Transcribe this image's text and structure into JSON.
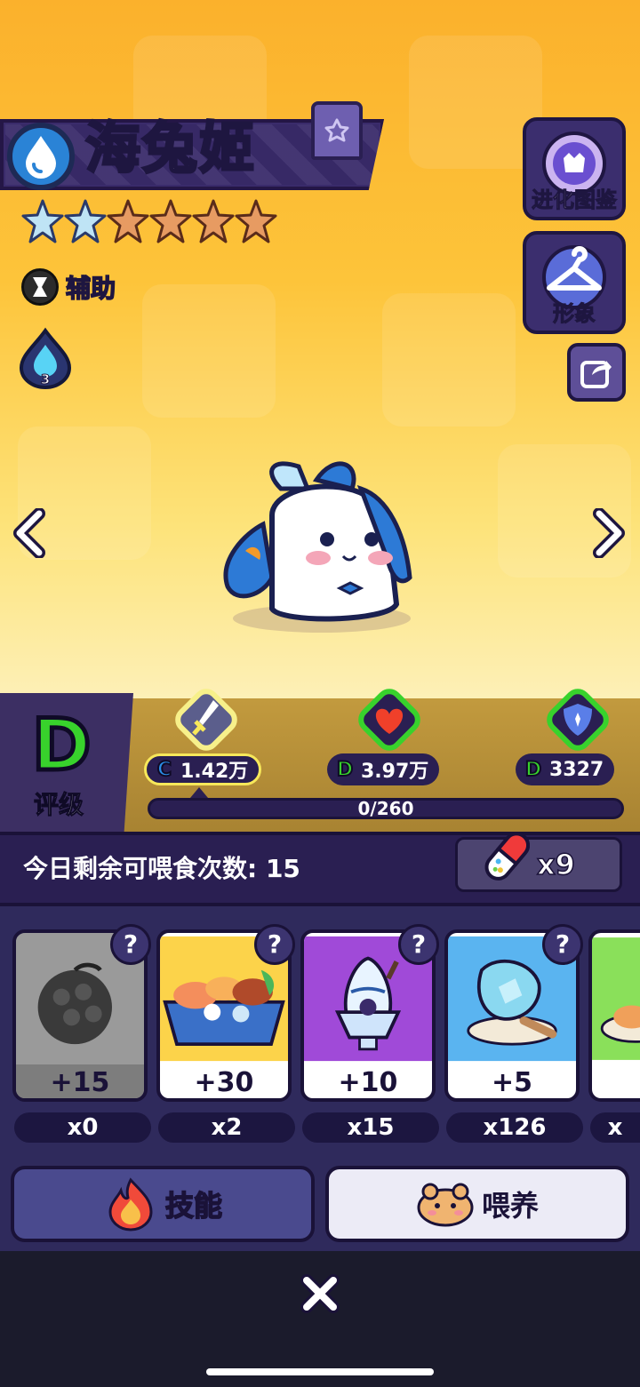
{
  "pet": {
    "name": "海兔姬",
    "element": "water",
    "stars_filled": 2,
    "stars_total": 6,
    "role": "辅助",
    "drop_level": "3"
  },
  "side": {
    "evolution_label": "进化图鉴",
    "appearance_label": "形象"
  },
  "grade": {
    "letter": "D",
    "label": "评级"
  },
  "stats": {
    "attack": {
      "grade": "C",
      "value": "1.42万"
    },
    "hp": {
      "grade": "D",
      "value": "3.97万"
    },
    "defense": {
      "grade": "D",
      "value": "3327"
    },
    "progress_text": "0/260",
    "progress_value": 0
  },
  "feed": {
    "remaining_text": "今日剩余可喂食次数: 15",
    "potion_count": "x9"
  },
  "foods": [
    {
      "value": "+15",
      "qty": "x0",
      "unknown": "?"
    },
    {
      "value": "+30",
      "qty": "x2",
      "unknown": "?"
    },
    {
      "value": "+10",
      "qty": "x15",
      "unknown": "?"
    },
    {
      "value": "+5",
      "qty": "x126",
      "unknown": "?"
    },
    {
      "value": "",
      "qty": "x",
      "unknown": ""
    }
  ],
  "buttons": {
    "skill": "技能",
    "feed": "喂养"
  },
  "colors": {
    "grade_green": "#38d22c",
    "grade_blue": "#2a8ee8",
    "panel_purple": "#2a1f52"
  }
}
